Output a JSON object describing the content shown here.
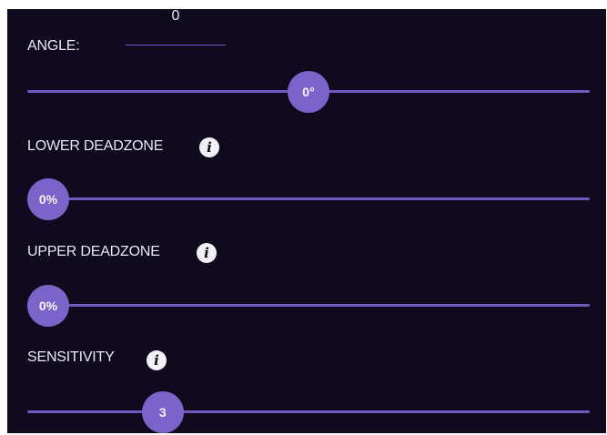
{
  "angle": {
    "label": "ANGLE:",
    "input_value": "0",
    "slider_display": "0°",
    "slider_fraction": 0.5
  },
  "lower_deadzone": {
    "label": "LOWER DEADZONE",
    "info_icon": "info-icon",
    "slider_display": "0%",
    "slider_fraction": 0.0
  },
  "upper_deadzone": {
    "label": "UPPER DEADZONE",
    "info_icon": "info-icon",
    "slider_display": "0%",
    "slider_fraction": 0.0
  },
  "sensitivity": {
    "label": "SENSITIVITY",
    "info_icon": "info-icon",
    "slider_display": "3",
    "slider_fraction": 0.22
  },
  "colors": {
    "background": "#0f0a1e",
    "accent": "#7a63c9",
    "track": "#6c5ac0",
    "text": "#e9e7f2"
  }
}
